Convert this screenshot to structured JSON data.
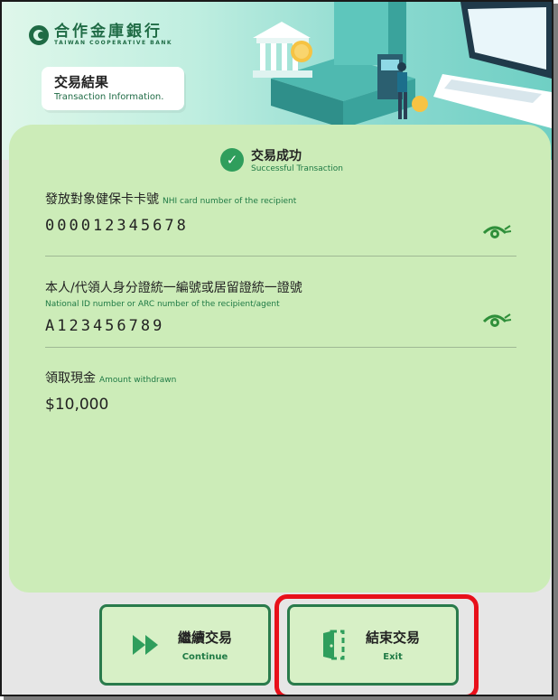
{
  "bank": {
    "name_cn": "合作金庫銀行",
    "name_en": "TAIWAN COOPERATIVE BANK"
  },
  "page": {
    "title_cn": "交易結果",
    "title_en": "Transaction Information."
  },
  "status": {
    "label_cn": "交易成功",
    "label_en": "Successful Transaction",
    "icon": "check-circle-icon"
  },
  "fields": {
    "nhi": {
      "label_cn": "發放對象健保卡卡號",
      "label_en": "NHI card number of the recipient",
      "value": "000012345678"
    },
    "id": {
      "label_cn": "本人/代領人身分證統一編號或居留證統一證號",
      "label_en": "National ID number or ARC number of the recipient/agent",
      "value": "A123456789"
    },
    "amount": {
      "label_cn": "領取現金",
      "label_en": "Amount withdrawn",
      "value": "$10,000"
    }
  },
  "buttons": {
    "continue": {
      "label_cn": "繼續交易",
      "label_en": "Continue",
      "icon": "fast-forward-icon"
    },
    "exit": {
      "label_cn": "結束交易",
      "label_en": "Exit",
      "icon": "door-exit-icon"
    }
  },
  "colors": {
    "brand_green": "#1f6b45",
    "card_bg": "#ccecb8",
    "highlight": "#e8101a"
  }
}
